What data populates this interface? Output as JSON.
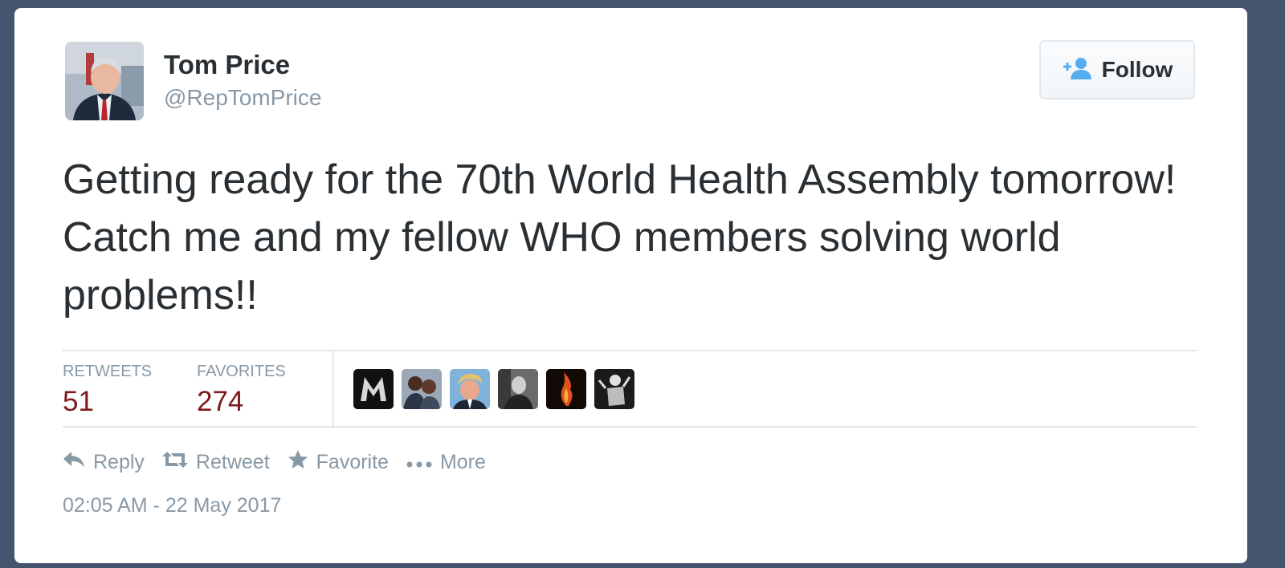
{
  "user": {
    "name": "Tom Price",
    "handle": "@RepTomPrice"
  },
  "follow_button": {
    "label": "Follow"
  },
  "tweet": {
    "text": "Getting ready for the 70th World Health Assembly tomorrow! Catch me and my fellow WHO members solving world problems!!",
    "timestamp": "02:05 AM - 22 May 2017"
  },
  "stats": {
    "retweets_label": "RETWEETS",
    "retweets_value": "51",
    "favorites_label": "FAVORITES",
    "favorites_value": "274"
  },
  "favoriters": [
    {
      "icon": "m-logo-avatar"
    },
    {
      "icon": "couple-photo-avatar"
    },
    {
      "icon": "man-portrait-avatar"
    },
    {
      "icon": "bw-man-avatar"
    },
    {
      "icon": "fire-avatar"
    },
    {
      "icon": "dancer-avatar"
    }
  ],
  "actions": {
    "reply": "Reply",
    "retweet": "Retweet",
    "favorite": "Favorite",
    "more": "More"
  },
  "colors": {
    "background": "#44546f",
    "count": "#7f1a1a",
    "muted": "#8899a6",
    "text": "#292f33",
    "follow_icon": "#55acee"
  }
}
